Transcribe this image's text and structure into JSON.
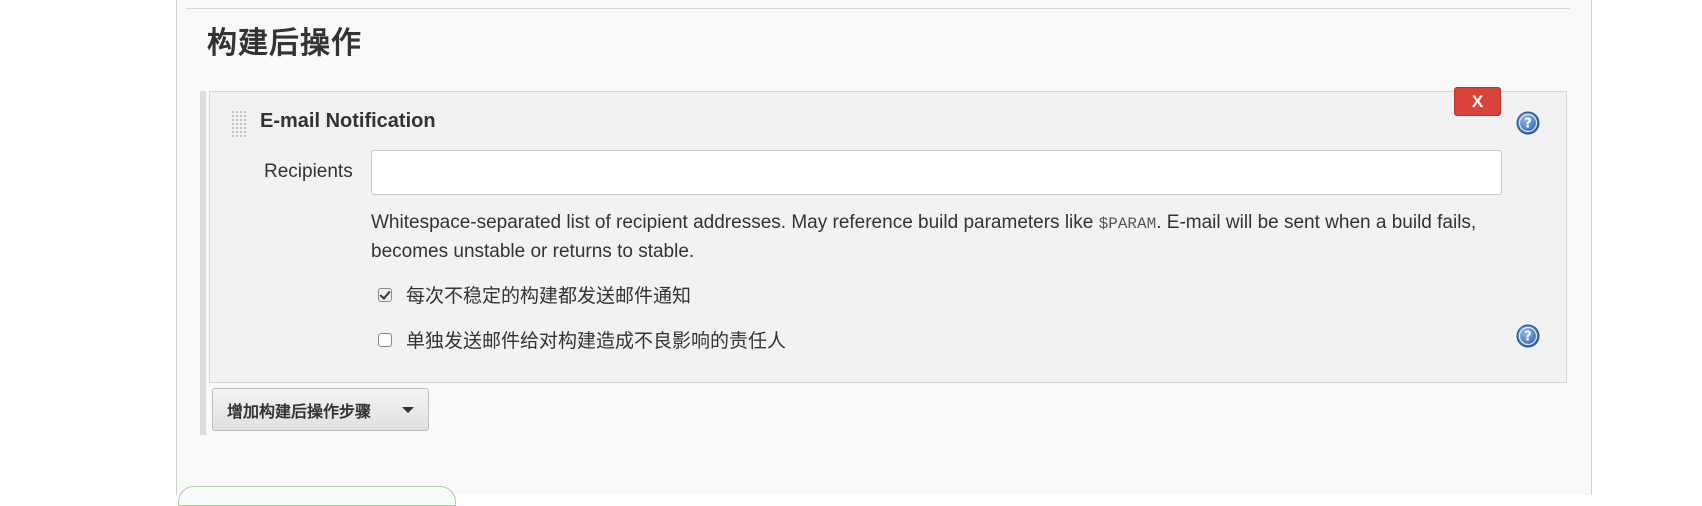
{
  "section": {
    "title": "构建后操作"
  },
  "step": {
    "title": "E-mail Notification",
    "delete_label": "X",
    "recipients": {
      "label": "Recipients",
      "value": "",
      "placeholder": ""
    },
    "help": {
      "before": "Whitespace-separated list of recipient addresses. May reference build parameters like ",
      "code": "$PARAM",
      "after": ". E-mail will be sent when a build fails, becomes unstable or returns to stable."
    },
    "options": [
      {
        "label": "每次不稳定的构建都发送邮件通知",
        "checked": true
      },
      {
        "label": "单独发送邮件给对构建造成不良影响的责任人",
        "checked": false
      }
    ]
  },
  "add_step_button": {
    "label": "增加构建后操作步骤"
  },
  "icons": {
    "help": "help-icon",
    "drag": "drag-handle-icon",
    "dropdown": "caret-down-icon"
  },
  "colors": {
    "delete_button": "#d9433a",
    "help_icon": "#3a73b8"
  }
}
